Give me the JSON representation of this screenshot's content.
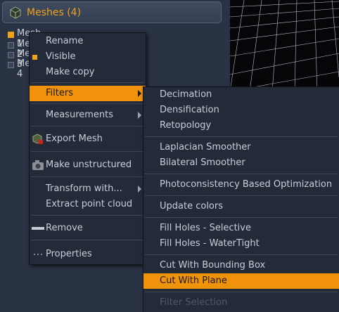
{
  "panel": {
    "title": "Meshes (4)"
  },
  "tree": {
    "items": [
      {
        "label": "Mesh 1",
        "checked": true
      },
      {
        "label": "Mesh 2",
        "checked": false
      },
      {
        "label": "Mesh 3",
        "checked": false
      },
      {
        "label": "Mesh 4",
        "checked": false
      }
    ]
  },
  "context_menu": {
    "rename": "Rename",
    "visible": "Visible",
    "make_copy": "Make copy",
    "filters": "Filters",
    "measurements": "Measurements",
    "export_mesh": "Export Mesh",
    "make_unstructured": "Make unstructured",
    "transform_with": "Transform with...",
    "extract_point_cloud": "Extract point cloud",
    "remove": "Remove",
    "properties": "Properties"
  },
  "filters_menu": {
    "decimation": "Decimation",
    "densification": "Densification",
    "retopology": "Retopology",
    "laplacian_smoother": "Laplacian Smoother",
    "bilateral_smoother": "Bilateral Smoother",
    "photoconsistency": "Photoconsistency Based Optimization",
    "update_colors": "Update colors",
    "fill_holes_selective": "Fill Holes - Selective",
    "fill_holes_watertight": "Fill Holes - WaterTight",
    "cut_bounding_box": "Cut With Bounding Box",
    "cut_plane": "Cut With Plane",
    "filter_selection": "Filter Selection"
  },
  "colors": {
    "accent": "#f0a21a",
    "highlight": "#f0920a",
    "menu_bg": "#232b39",
    "panel_bg": "#2a3344"
  },
  "icons": [
    "cube-icon",
    "export-mesh-icon",
    "camera-icon",
    "remove-bar-icon",
    "properties-dots-icon",
    "submenu-arrow-icon"
  ]
}
